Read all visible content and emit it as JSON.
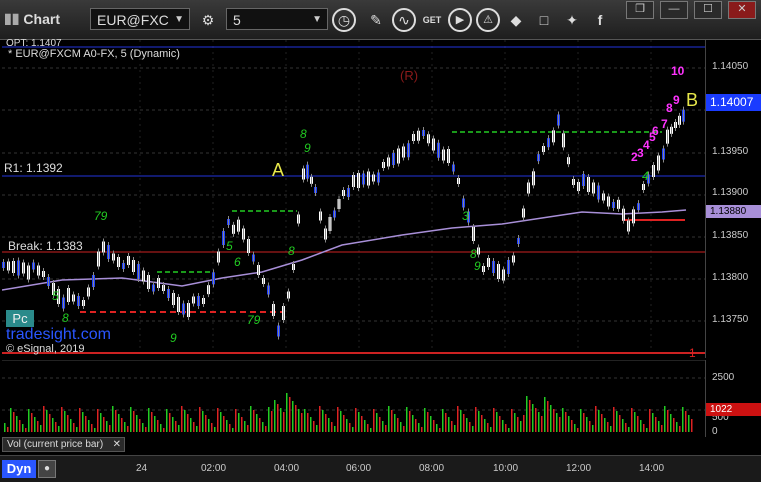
{
  "toolbar": {
    "title": "Chart",
    "symbol": "EUR@FXC",
    "interval": "5",
    "window_buttons": [
      "❒",
      "—",
      "☐",
      "✕"
    ]
  },
  "chart": {
    "header_partial": "OPT: 1.1407",
    "series_title": "* EUR@FXCM A0-FX, 5 (Dynamic)",
    "r_label": "(R)",
    "r1_label": "R1: 1.1392",
    "break_label": "Break:  1.1383",
    "a_label": "A",
    "b_label": "B",
    "pc_label": "Pc",
    "watermark": "tradesight.com",
    "copyright": "© eSignal, 2019",
    "marker_1": "1",
    "seq_10": "10",
    "seq_9": "9",
    "seq_8": "8",
    "seq_7": "7",
    "seq_6": "6",
    "seq_5": "5",
    "seq_4": "4",
    "seq_3": "3",
    "seq_2": "2",
    "price_ticks": [
      "1.14050",
      "1.14000",
      "1.13950",
      "1.13900",
      "1.13850",
      "1.13800",
      "1.13750"
    ],
    "last_price": "1.14007",
    "ma_price": "1.13880",
    "colors": {
      "up": "#ffffff",
      "down": "#1a3cff",
      "r1": "#2233dd",
      "break": "#cc2222",
      "ma": "#a88fd8",
      "green": "#22cc22",
      "magenta": "#ff33ff"
    }
  },
  "volume": {
    "title": "Vol (current price bar)",
    "ticks": [
      "2500",
      "500",
      "0"
    ],
    "last": "1022"
  },
  "bottom": {
    "dyn": "Dyn",
    "time_labels": [
      "24",
      "02:00",
      "04:00",
      "06:00",
      "08:00",
      "10:00",
      "12:00",
      "14:00"
    ]
  }
}
